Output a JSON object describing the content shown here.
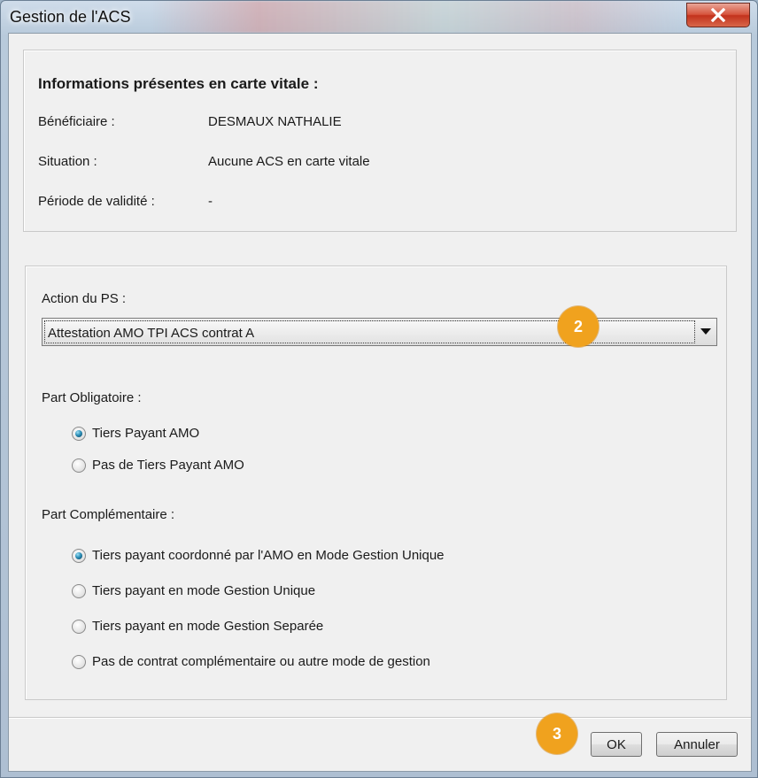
{
  "window": {
    "title": "Gestion de l'ACS"
  },
  "card_info": {
    "heading": "Informations présentes en carte vitale :",
    "rows": [
      {
        "label": "Bénéficiaire :",
        "value": "DESMAUX NATHALIE"
      },
      {
        "label": "Situation :",
        "value": "Aucune ACS en carte vitale"
      },
      {
        "label": "Période de validité :",
        "value": "-"
      }
    ]
  },
  "action": {
    "label": "Action du PS :",
    "selected": "Attestation AMO TPI ACS contrat A"
  },
  "part_obligatoire": {
    "label": "Part Obligatoire :",
    "options": [
      {
        "label": "Tiers Payant AMO",
        "checked": true
      },
      {
        "label": "Pas de Tiers Payant AMO",
        "checked": false
      }
    ]
  },
  "part_complementaire": {
    "label": "Part Complémentaire :",
    "options": [
      {
        "label": "Tiers payant coordonné par l'AMO en Mode Gestion Unique",
        "checked": true
      },
      {
        "label": "Tiers payant en mode Gestion Unique",
        "checked": false
      },
      {
        "label": "Tiers payant en mode Gestion Separée",
        "checked": false
      },
      {
        "label": "Pas de contrat complémentaire ou autre mode de gestion",
        "checked": false
      }
    ]
  },
  "buttons": {
    "ok": "OK",
    "cancel": "Annuler"
  },
  "annotations": {
    "badge_2": "2",
    "badge_3": "3",
    "badge_color": "#f0a21e"
  },
  "colors": {
    "close_button": "#c8432a",
    "radio_checked": "#2c8fb8"
  }
}
